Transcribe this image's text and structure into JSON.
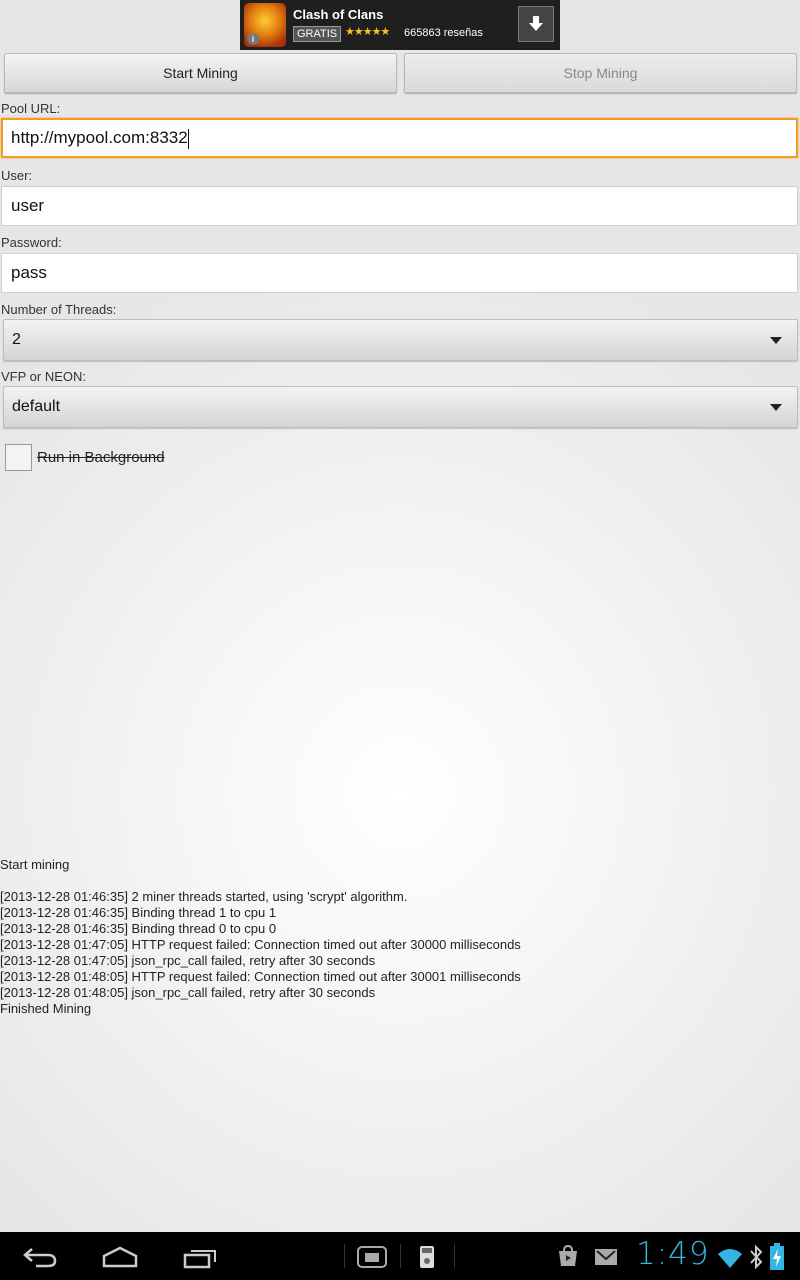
{
  "ad": {
    "title": "Clash of Clans",
    "badge": "GRATIS",
    "stars": "★★★★★",
    "rating": 4.5,
    "reviews": "665863 reseñas",
    "icon": "clash-of-clans-app-icon",
    "download_icon": "download-arrow-icon",
    "info_icon": "i"
  },
  "actions": {
    "start_label": "Start Mining",
    "stop_label": "Stop Mining"
  },
  "form": {
    "pool_url_label": "Pool URL:",
    "pool_url_value": "http://mypool.com:8332",
    "user_label": "User:",
    "user_value": "user",
    "password_label": "Password:",
    "password_value": "pass",
    "threads_label": "Number of Threads:",
    "threads_value": "2",
    "vfp_label": "VFP or NEON:",
    "vfp_value": "default",
    "background_label": "Run in Background",
    "background_checked": false
  },
  "log": {
    "lines": [
      "Start mining",
      "",
      "[2013-12-28 01:46:35] 2 miner threads started, using 'scrypt' algorithm.",
      "[2013-12-28 01:46:35] Binding thread 1 to cpu 1",
      "[2013-12-28 01:46:35] Binding thread 0 to cpu 0",
      "[2013-12-28 01:47:05] HTTP request failed: Connection timed out after 30000 milliseconds",
      "[2013-12-28 01:47:05] json_rpc_call failed, retry after 30 seconds",
      "[2013-12-28 01:48:05] HTTP request failed: Connection timed out after 30001 milliseconds",
      "[2013-12-28 01:48:05] json_rpc_call failed, retry after 30 seconds",
      "Finished Mining"
    ]
  },
  "navbar": {
    "clock": "1:49",
    "icons": [
      "back-icon",
      "home-icon",
      "recent-apps-icon",
      "screenshot-icon",
      "sd-card-icon",
      "play-store-icon",
      "gmail-icon",
      "wifi-icon",
      "bluetooth-icon",
      "battery-charging-icon"
    ]
  },
  "colors": {
    "focus_accent": "#f39c1f",
    "clock_blue": "#36b5e5",
    "star_gold": "#f5c518"
  }
}
